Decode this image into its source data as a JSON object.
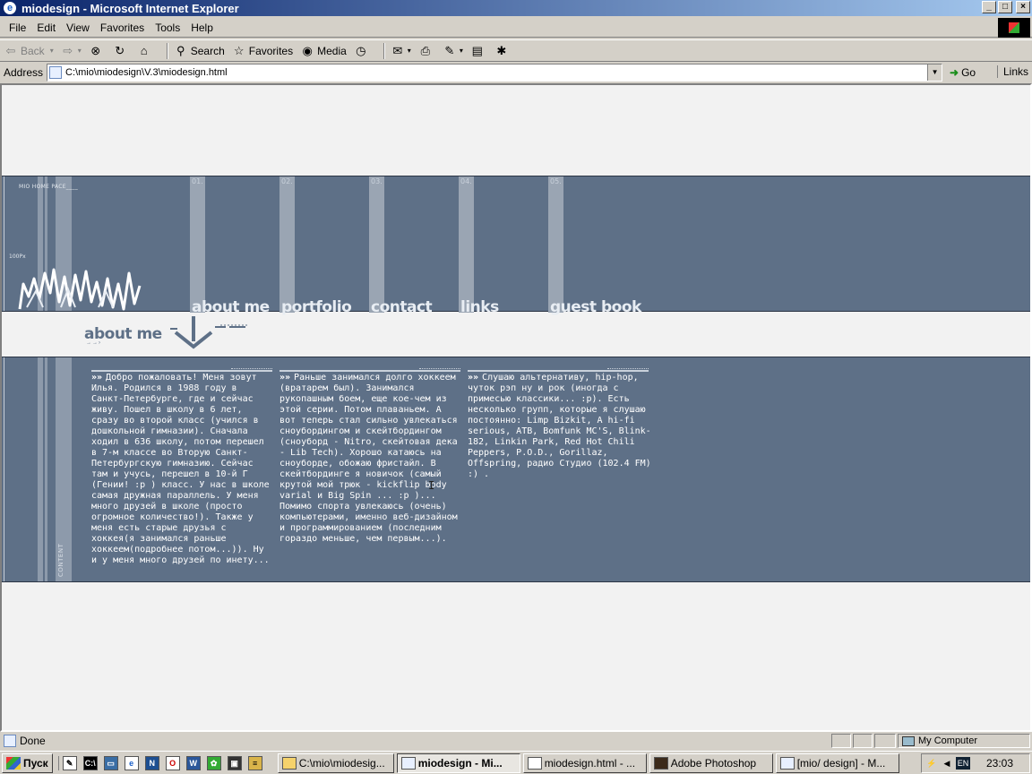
{
  "window": {
    "title": "miodesign - Microsoft Internet Explorer",
    "min": "_",
    "max": "□",
    "close": "×"
  },
  "menu": {
    "items": [
      "File",
      "Edit",
      "View",
      "Favorites",
      "Tools",
      "Help"
    ]
  },
  "toolbar": {
    "back": "Back",
    "search": "Search",
    "favorites": "Favorites",
    "media": "Media"
  },
  "address": {
    "label": "Address",
    "value": "C:\\mio\\miodesign\\V.3\\miodesign.html",
    "go": "Go",
    "links": "Links"
  },
  "page": {
    "home_label": "MIO HOME PACE____",
    "px_label": "100Px",
    "nav": [
      {
        "num": "01.",
        "label": "about me"
      },
      {
        "num": "02.",
        "label": "portfolio"
      },
      {
        "num": "03.",
        "label": "contact"
      },
      {
        "num": "04.",
        "label": "links"
      },
      {
        "num": "05.",
        "label": "guest book"
      }
    ],
    "section_title": "about me",
    "section_sub": "→→›",
    "content_label": "CONTENT",
    "chevrons": "»»",
    "col1": "Добро пожаловать! Меня зовут Илья. Родился в 1988 году в Санкт-Петербурге, где и сейчас живу. Пошел в школу в 6 лет, сразу во второй класс (учился в дошкольной гимназии). Сначала ходил в 636 школу, потом перешел в 7-м классе во Вторую Санкт-Петербургскую гимназию. Сейчас там и учусь, перешел в 10-й Г (Гении! :p ) класс. У нас в школе самая дружная параллель. У меня много друзей в школе (просто огромное количество!). Также у меня есть старые друзья с хоккея(я занимался раньше хоккеем(подробнее потом...)). Ну и у меня много друзей по инету...",
    "col2": "Раньше занимался долго хоккеем (вратарем был). Занимался рукопашным боем, еще кое-чем из этой серии. Потом плаваньем. А вот теперь стал сильно увлекаться сноубордингом и скейтбордингом (сноуборд - Nitro, скейтовая дека - Lib Tech). Хорошо катаюсь на сноуборде, обожаю фристайл. В скейтбординге я новичок (самый крутой мой трюк - kickflip body varial и Big Spin ... :p )... Помимо спорта увлекаюсь (очень) компьютерами, именно веб-дизайном и программированием (последним гораздо меньше, чем первым...).",
    "col3": "Слушаю альтернативу, hip-hop, чуток рэп ну и рок (иногда с примесью классики... :p). Есть несколько групп, которые я слушаю постоянно: Limp Bizkit, A hi-fi serious, ATB, Bomfunk MC'S, Blink-182, Linkin Park, Red Hot Chili Peppers, P.O.D., Gorillaz, Offspring, радио Студио (102.4 FM) :) ."
  },
  "status": {
    "text": "Done",
    "zone": "My Computer"
  },
  "taskbar": {
    "start": "Пуск",
    "tasks": [
      "C:\\mio\\miodesig...",
      "miodesign - Mi...",
      "miodesign.html - ...",
      "Adobe Photoshop",
      "[mio/ design] - M..."
    ],
    "lang": "EN",
    "time": "23:03"
  },
  "colors": {
    "band": "#5e7087",
    "stripe": "#9aa5b3",
    "page_bg": "#f2f2f2"
  }
}
